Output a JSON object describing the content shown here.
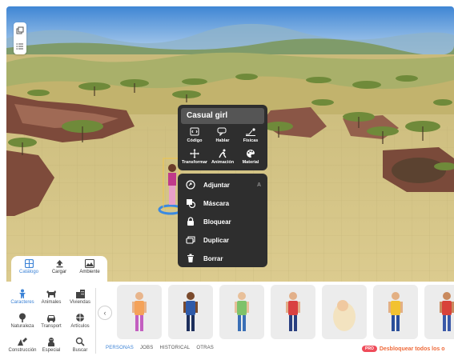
{
  "context_menu": {
    "title": "Casual girl",
    "actions": [
      {
        "label": "Código",
        "icon": "code-icon"
      },
      {
        "label": "Hablar",
        "icon": "speech-bubble-icon"
      },
      {
        "label": "Físicas",
        "icon": "physics-icon"
      },
      {
        "label": "Transformar",
        "icon": "move-arrows-icon"
      },
      {
        "label": "Animación",
        "icon": "running-figure-icon"
      },
      {
        "label": "Material",
        "icon": "palette-icon"
      }
    ],
    "items": [
      {
        "label": "Adjuntar",
        "icon": "attach-icon",
        "shortcut": "A"
      },
      {
        "label": "Máscara",
        "icon": "mask-icon"
      },
      {
        "label": "Bloquear",
        "icon": "lock-icon"
      },
      {
        "label": "Duplicar",
        "icon": "duplicate-icon"
      },
      {
        "label": "Borrar",
        "icon": "trash-icon"
      }
    ]
  },
  "left_toolbar": {
    "tools": [
      "layers-icon",
      "list-icon"
    ]
  },
  "bottom_tabs": [
    {
      "label": "Catálogo",
      "icon": "catalog-icon",
      "active": true
    },
    {
      "label": "Cargar",
      "icon": "upload-icon",
      "active": false
    },
    {
      "label": "Ambiente",
      "icon": "environment-icon",
      "active": false
    }
  ],
  "categories": [
    {
      "label": "Caracteres",
      "icon": "person-icon",
      "active": true
    },
    {
      "label": "Animales",
      "icon": "animal-icon",
      "active": false
    },
    {
      "label": "Viviendas",
      "icon": "buildings-icon",
      "active": false
    },
    {
      "label": "Naturaleza",
      "icon": "nature-icon",
      "active": false
    },
    {
      "label": "Transport",
      "icon": "car-icon",
      "active": false
    },
    {
      "label": "Artículos",
      "icon": "items-icon",
      "active": false
    },
    {
      "label": "Construcción",
      "icon": "construction-icon",
      "active": false
    },
    {
      "label": "Especial",
      "icon": "special-icon",
      "active": false
    },
    {
      "label": "Buscar",
      "icon": "search-icon",
      "active": false
    }
  ],
  "character_cards": [
    {
      "name": "character-1",
      "shirt": "#f4a259",
      "pants": "#c35fc0",
      "skin": "#e8b58c"
    },
    {
      "name": "character-2",
      "shirt": "#2e5aa8",
      "pants": "#1d2f5c",
      "skin": "#7a4a2c"
    },
    {
      "name": "character-3",
      "shirt": "#7ec26a",
      "pants": "#3a6fb6",
      "skin": "#e8c09a"
    },
    {
      "name": "character-4",
      "shirt": "#d94141",
      "pants": "#2a3f80",
      "skin": "#e2b08a"
    },
    {
      "name": "character-5",
      "shirt": "#f3e3c0",
      "pants": "#f3e3c0",
      "skin": "#f0c9a0"
    },
    {
      "name": "character-6",
      "shirt": "#f2c230",
      "pants": "#2a4f9a",
      "skin": "#e3b084"
    },
    {
      "name": "character-7",
      "shirt": "#d8423a",
      "pants": "#3a59a8",
      "skin": "#c98a5e"
    }
  ],
  "sub_tabs": [
    {
      "label": "PERSONAS",
      "active": true
    },
    {
      "label": "JOBS",
      "active": false
    },
    {
      "label": "HISTORICAL",
      "active": false
    },
    {
      "label": "OTRAS",
      "active": false
    }
  ],
  "unlock": {
    "badge": "PRO",
    "label": "Desbloquear todos los o"
  },
  "colors": {
    "accent": "#3b82d6",
    "menu_bg": "#2e2e2e",
    "pro": "#ef4c5a"
  }
}
